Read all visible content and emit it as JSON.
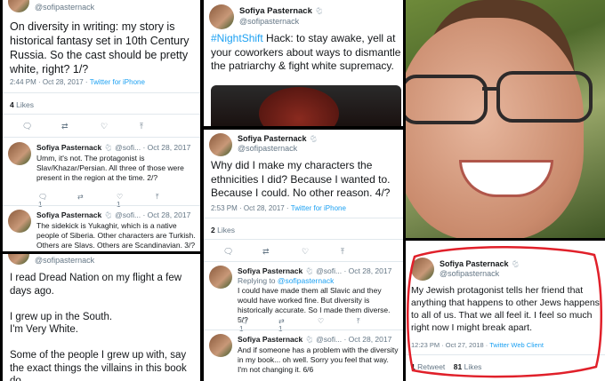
{
  "p1": {
    "handle": "@sofipasternack",
    "text": "On diversity in writing: my story is historical fantasy set in 10th Century Russia. So the cast should be pretty white, right? 1/?",
    "time": "2:44 PM · Oct 28, 2017 · ",
    "client": "Twitter for iPhone",
    "likes_count": "4",
    "likes_label": "Likes",
    "replies": [
      {
        "name": "Sofiya Pasternack",
        "handle": "@sofi...",
        "date": "· Oct 28, 2017",
        "text": "Umm, it's not. The protagonist is Slav/Khazar/Persian. All three of those were present in the region at the time. 2/?",
        "reply_count": "1",
        "like_count": "1"
      },
      {
        "name": "Sofiya Pasternack",
        "handle": "@sofi...",
        "date": "· Oct 28, 2017",
        "text": "The sidekick is Yukaghir, which is a native people of Siberia. Other characters are Turkish. Others are Slavs. Others are Scandinavian. 3/?"
      }
    ]
  },
  "p2": {
    "handle": "@sofipasternack",
    "text": "I read Dread Nation on my flight a few days ago.\n\nI grew up in the South.\nI'm Very White.\n\nSome of the people I grew up with, say the exact things the villains in this book do."
  },
  "p3": {
    "name": "Sofiya Pasternack",
    "handle": "@sofipasternack",
    "hashtag": "#NightShift",
    "text": " Hack: to stay awake, yell at your coworkers about ways to dismantle the patriarchy & fight white supremacy."
  },
  "p4": {
    "name": "Sofiya Pasternack",
    "handle": "@sofipasternack",
    "text": "Why did I make my characters the ethnicities I did? Because I wanted to. Because I could. No other reason. 4/?",
    "time": "2:53 PM · Oct 28, 2017 · ",
    "client": "Twitter for iPhone",
    "likes_count": "2",
    "likes_label": "Likes",
    "replies": [
      {
        "name": "Sofiya Pasternack",
        "handle": "@sofi...",
        "date": "· Oct 28, 2017",
        "replying": "Replying to ",
        "replying_handle": "@sofipasternack",
        "text": "I could have made them all Slavic and they would have worked fine. But diversity is historically accurate. So I made them diverse. 5/?",
        "reply_count": "1",
        "retweet_count": "1"
      },
      {
        "name": "Sofiya Pasternack",
        "handle": "@sofi...",
        "date": "· Oct 28, 2017",
        "text": "And if someone has a problem with the diversity in my book... oh well. Sorry you feel that way. I'm not changing it. 6/6"
      }
    ]
  },
  "p5": {
    "name": "Sofiya Pasternack",
    "handle": "@sofipasternack",
    "text": "My Jewish protagonist tells her friend that anything that happens to other Jews happens to all of us. That we all feel it. I feel so much right now I might break apart.",
    "time": "12:23 PM · Oct 27, 2018 · ",
    "client": "Twitter Web Client",
    "retweets_count": "1",
    "retweets_label": "Retweet",
    "likes_count": "81",
    "likes_label": "Likes"
  },
  "icons": {
    "reply": "reply-icon",
    "retweet": "retweet-icon",
    "like": "heart-icon",
    "share": "share-icon",
    "goat": "goat-icon"
  },
  "colors": {
    "link": "#1da1f2",
    "circle": "#e0202a"
  }
}
